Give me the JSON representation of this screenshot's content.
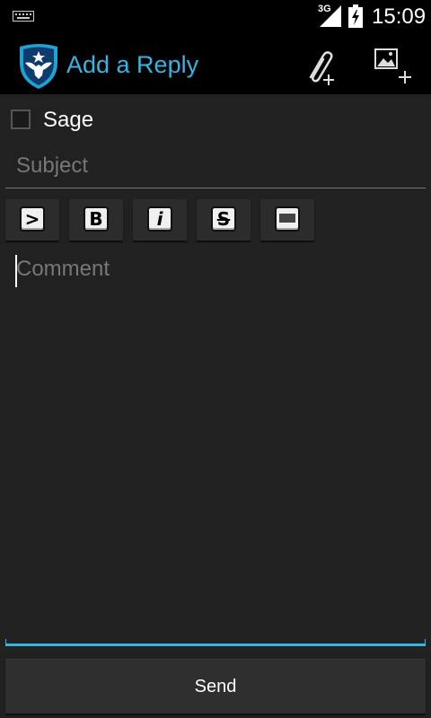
{
  "status_bar": {
    "network": "3G",
    "time": "15:09",
    "icons": [
      "keyboard-icon",
      "signal-icon",
      "battery-charging-icon"
    ]
  },
  "action_bar": {
    "title": "Add a Reply",
    "app_icon": "shield-eagle-icon",
    "actions": [
      {
        "name": "attach-file-icon"
      },
      {
        "name": "add-image-icon"
      }
    ],
    "accent_color": "#33b5e5"
  },
  "form": {
    "sage_label": "Sage",
    "sage_checked": false,
    "subject_placeholder": "Subject",
    "subject_value": "",
    "comment_placeholder": "Comment",
    "comment_value": "",
    "format_buttons": [
      {
        "glyph": ">",
        "name": "quote-format-icon"
      },
      {
        "glyph": "B",
        "name": "bold-format-icon"
      },
      {
        "glyph": "i",
        "name": "italic-format-icon"
      },
      {
        "glyph": "S",
        "name": "strikethrough-format-icon"
      },
      {
        "glyph": "",
        "name": "spoiler-format-icon"
      }
    ],
    "send_label": "Send"
  }
}
